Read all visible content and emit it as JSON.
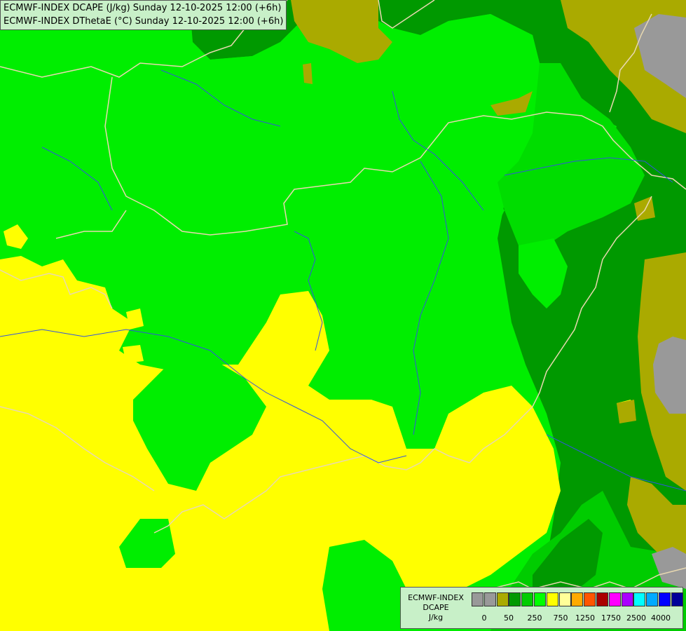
{
  "header": {
    "line1": "ECMWF-INDEX DCAPE (J/kg) Sunday 12-10-2025 12:00 (+6h)",
    "line2": "ECMWF-INDEX DThetaE (°C) Sunday 12-10-2025 12:00 (+6h)"
  },
  "legend": {
    "title_lines": [
      "ECMWF-INDEX",
      "DCAPE",
      "J/kg"
    ],
    "colors": [
      "#999999",
      "#999999",
      "#aaaa00",
      "#009900",
      "#00cc00",
      "#00ff00",
      "#ffff00",
      "#ffff99",
      "#ffaa00",
      "#ff5500",
      "#aa0000",
      "#ff00ff",
      "#aa00ff",
      "#00ffff",
      "#00aaff",
      "#0000ff",
      "#000099"
    ],
    "ticks": [
      "0",
      "50",
      "250",
      "750",
      "1250",
      "1750",
      "2500",
      "4000"
    ]
  },
  "map_colors": {
    "light_green": "#00ee00",
    "dark_green": "#009900",
    "mid_green": "#00cc00",
    "yellow": "#ffff00",
    "olive": "#aaaa00",
    "gray": "#999999",
    "border": "#e8d8b0",
    "river": "#3355dd"
  }
}
